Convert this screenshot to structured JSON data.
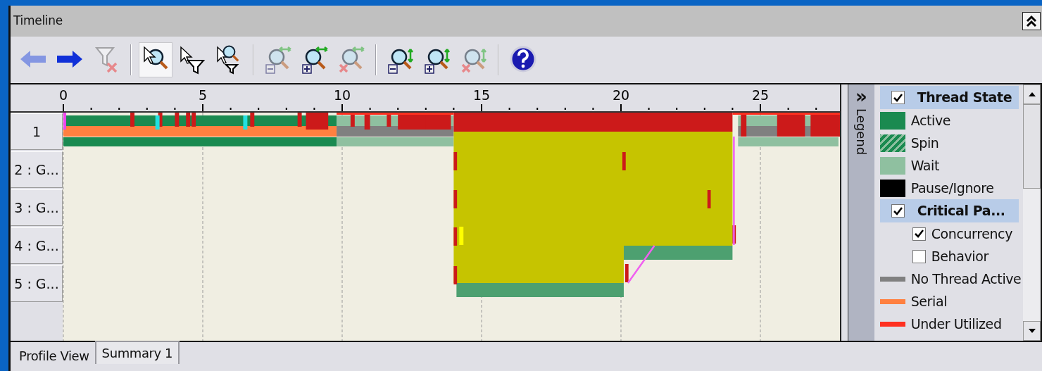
{
  "panel": {
    "title": "Timeline"
  },
  "toolbar": [
    {
      "kind": "back",
      "disabled": true,
      "selected": false
    },
    {
      "kind": "forward",
      "disabled": false,
      "selected": false
    },
    {
      "kind": "unfilter",
      "disabled": true,
      "selected": false
    },
    {
      "kind": "separator"
    },
    {
      "kind": "selectzoom",
      "disabled": false,
      "selected": true
    },
    {
      "kind": "selectfilter",
      "disabled": false,
      "selected": false
    },
    {
      "kind": "selectzoomfilter",
      "disabled": false,
      "selected": false
    },
    {
      "kind": "separator"
    },
    {
      "kind": "hzoomout",
      "disabled": true,
      "selected": false
    },
    {
      "kind": "hzoomin",
      "disabled": false,
      "selected": false
    },
    {
      "kind": "hzoomreset",
      "disabled": true,
      "selected": false
    },
    {
      "kind": "separator"
    },
    {
      "kind": "vzoomout",
      "disabled": false,
      "selected": false
    },
    {
      "kind": "vzoomin",
      "disabled": false,
      "selected": false
    },
    {
      "kind": "vzoomreset",
      "disabled": true,
      "selected": false
    },
    {
      "kind": "separator"
    },
    {
      "kind": "help",
      "disabled": false,
      "selected": false
    }
  ],
  "timeline": {
    "axis_labels": [
      "0",
      "5",
      "10",
      "15",
      "20",
      "25"
    ],
    "rows": [
      {
        "label": "1"
      },
      {
        "label": "2 : G..."
      },
      {
        "label": "3 : G..."
      },
      {
        "label": "4 : G..."
      },
      {
        "label": "5 : G..."
      }
    ]
  },
  "legend": {
    "collapse_glyph": "»",
    "title": "Legend",
    "items": [
      {
        "kind": "group",
        "label": "Thread State",
        "checked": true
      },
      {
        "kind": "swatch",
        "label": "Active",
        "color": "#1a8a50"
      },
      {
        "kind": "hatched",
        "label": "Spin",
        "color": "#1a8a50"
      },
      {
        "kind": "swatch",
        "label": "Wait",
        "color": "#8fc0a0"
      },
      {
        "kind": "swatch",
        "label": "Pause/Ignore",
        "color": "#000000"
      },
      {
        "kind": "group",
        "label": "Critical Pa...",
        "checked": true
      },
      {
        "kind": "check",
        "label": "Concurrency",
        "checked": true
      },
      {
        "kind": "check",
        "label": "Behavior",
        "checked": false
      },
      {
        "kind": "line",
        "label": "No Thread Active",
        "color": "#808080"
      },
      {
        "kind": "line",
        "label": "Serial",
        "color": "#ff8040"
      },
      {
        "kind": "line",
        "label": "Under Utilized",
        "color": "#ff3020"
      }
    ]
  },
  "tabs": [
    {
      "label": "Profile View",
      "selected": false
    },
    {
      "label": "Summary 1",
      "selected": true
    }
  ]
}
